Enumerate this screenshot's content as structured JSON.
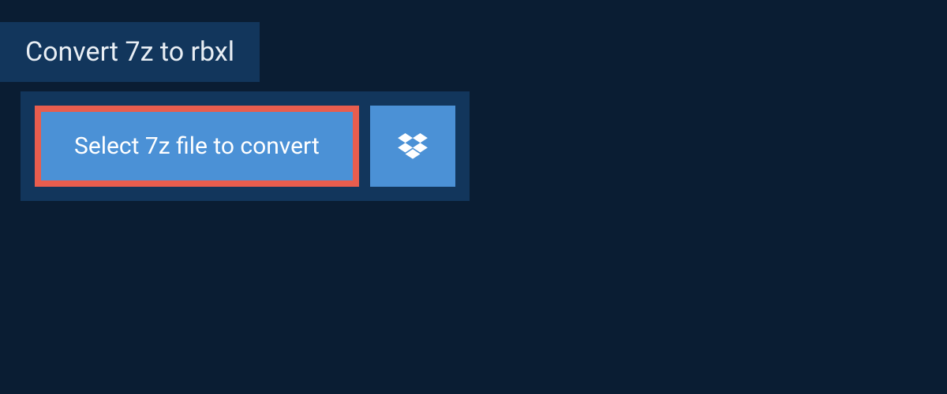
{
  "tab": {
    "title": "Convert 7z to rbxl"
  },
  "upload": {
    "select_label": "Select 7z file to convert"
  },
  "colors": {
    "page_bg": "#0a1d33",
    "panel_bg": "#12365c",
    "button_bg": "#4b91d6",
    "highlight_border": "#e85d4e",
    "text": "#e8eef4"
  }
}
